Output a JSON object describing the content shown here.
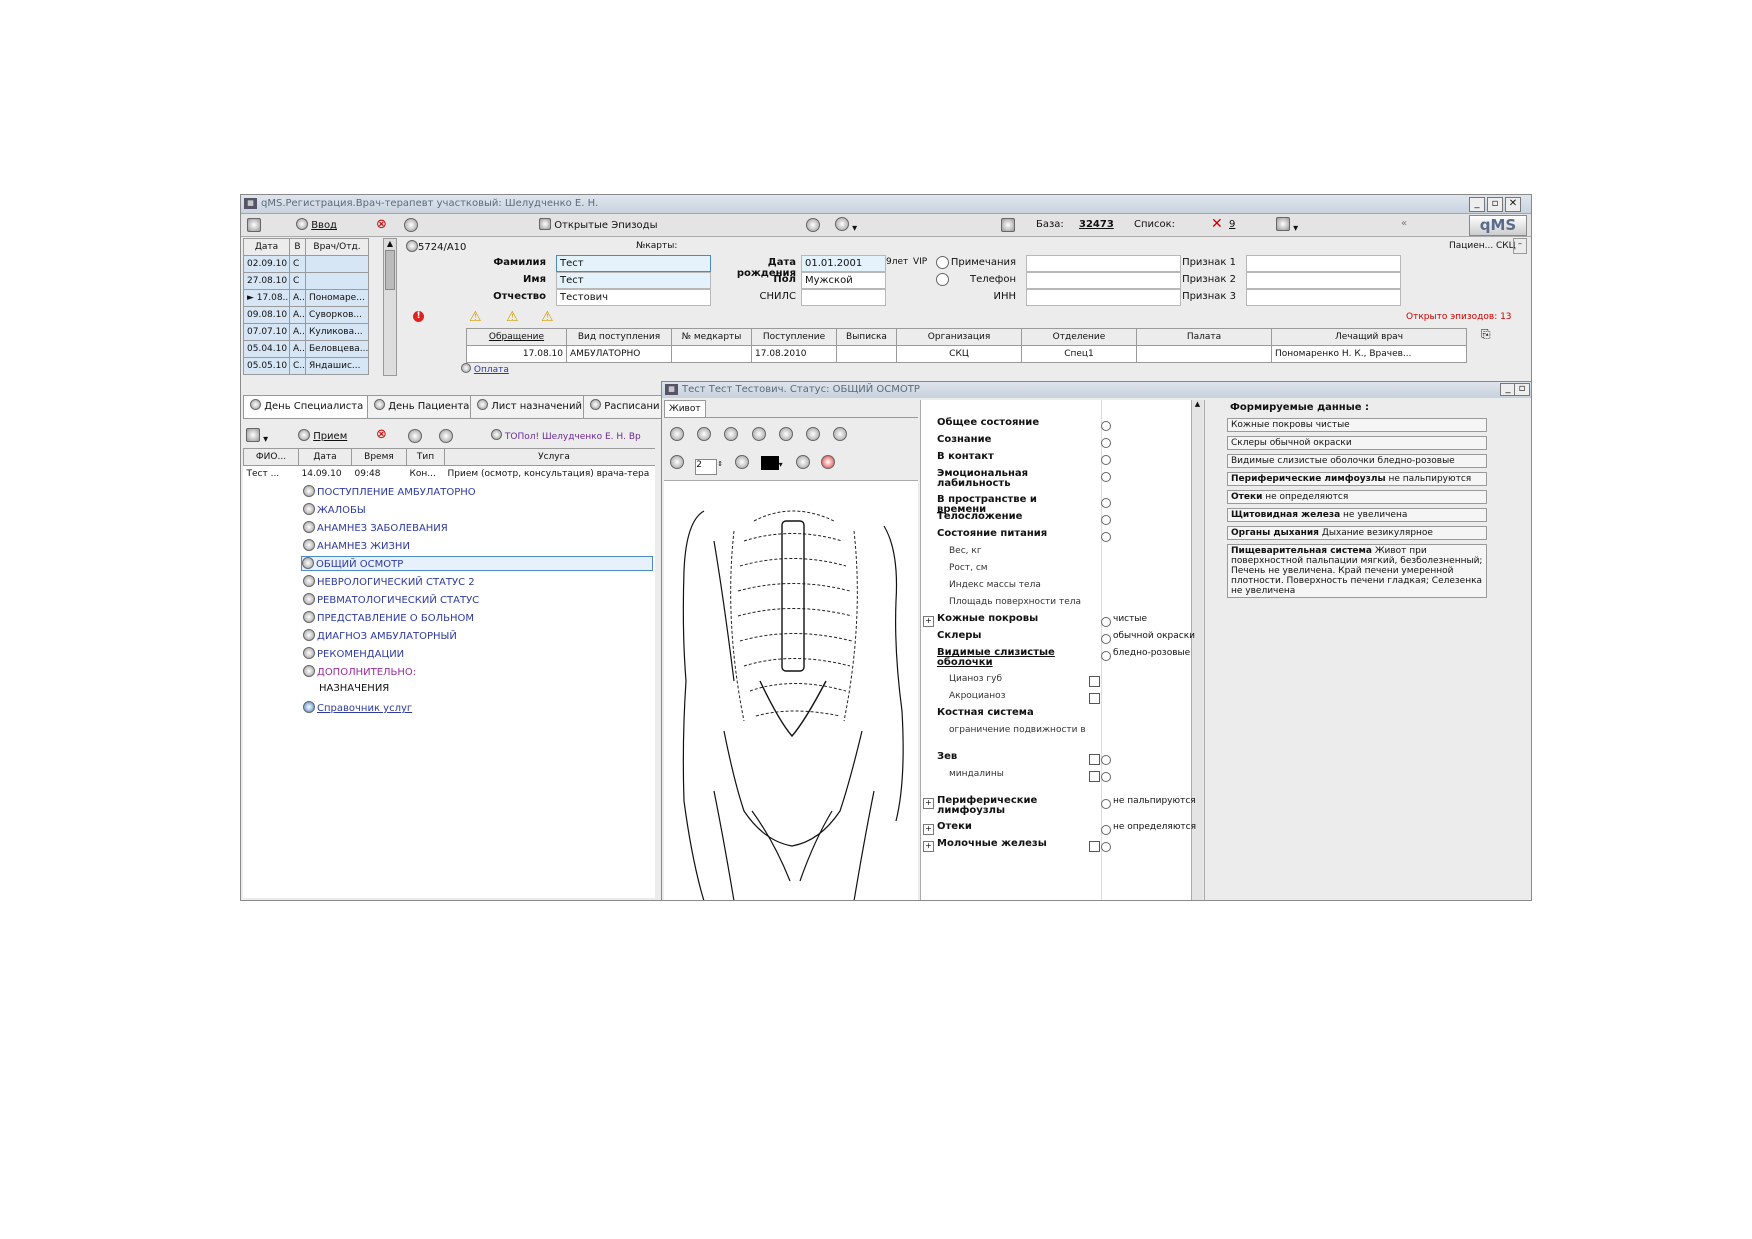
{
  "window": {
    "title": "qMS.Регистрация.Врач-терапевт участковый: Шелудченко Е. Н.",
    "min": "_",
    "max": "▫",
    "close": "✕"
  },
  "toolbar": {
    "vvod": "Ввод",
    "open_episodes": "Открытые Эпизоды",
    "baza_label": "База:",
    "baza_value": "32473",
    "spisok_label": "Список:",
    "spisok_value": "9",
    "logo": "qMS"
  },
  "visits_table": {
    "headers": [
      "Дата",
      "В",
      "Врач/Отд."
    ],
    "rows": [
      [
        "02.09.10",
        "С",
        ""
      ],
      [
        "27.08.10",
        "С",
        ""
      ],
      [
        "► 17.08...",
        "А...",
        "Пономаре..."
      ],
      [
        "09.08.10",
        "А...",
        "Суворков..."
      ],
      [
        "07.07.10",
        "А...",
        "Куликова..."
      ],
      [
        "05.04.10",
        "А...",
        "Беловцева..."
      ],
      [
        "05.05.10",
        "С...",
        "Яндашис..."
      ]
    ]
  },
  "patient": {
    "id": "5724/А10",
    "nkarty": "№карты:",
    "patient_label": "Пациен...",
    "patient_value": "СКЦ",
    "familia_label": "Фамилия",
    "familia": "Тест",
    "imya_label": "Имя",
    "imya": "Тест",
    "otchestvo_label": "Отчество",
    "otchestvo": "Тестович",
    "dob_label": "Дата рождения",
    "dob": "01.01.2001",
    "age": "9лет",
    "vip": "VIP",
    "pol_label": "Пол",
    "pol": "Мужской",
    "snils_label": "СНИЛС",
    "prim_label": "Примечания",
    "tel_label": "Телефон",
    "inn_label": "ИНН",
    "p1": "Признак 1",
    "p2": "Признак 2",
    "p3": "Признак 3",
    "open_episodes": "Открыто эпизодов: 13",
    "oplata": "Оплата"
  },
  "episodes_table": {
    "headers": [
      "Обращение",
      "Вид поступления",
      "№ медкарты",
      "Поступление",
      "Выписка",
      "Организация",
      "Отделение",
      "Палата",
      "Лечащий врач"
    ],
    "row": [
      "17.08.10",
      "АМБУЛАТОРНО",
      "",
      "17.08.2010",
      "",
      "СКЦ",
      "Спец1",
      "",
      "Пономаренко Н. К., Врачев..."
    ]
  },
  "tabs": [
    "День Специалиста",
    "День Пациента",
    "Лист назначений",
    "Расписани"
  ],
  "appointments": {
    "toolbar_priem": "Прием",
    "doctor": "ТОПол! Шелудченко Е. Н. Вр",
    "headers": [
      "ФИО...",
      "Дата",
      "Время",
      "Тип",
      "Услуга"
    ],
    "row": [
      "Тест ...",
      "14.09.10",
      "09:48",
      "Кон...",
      "Прием (осмотр, консультация) врача-тера"
    ],
    "tree": [
      "ПОСТУПЛЕНИЕ АМБУЛАТОРНО",
      "ЖАЛОБЫ",
      "АНАМНЕЗ ЗАБОЛЕВАНИЯ",
      "АНАМНЕЗ ЖИЗНИ",
      "ОБЩИЙ ОСМОТР",
      "НЕВРОЛОГИЧЕСКИЙ СТАТУС 2",
      "РЕВМАТОЛОГИЧЕСКИЙ СТАТУС",
      "ПРЕДСТАВЛЕНИЕ О БОЛЬНОМ",
      "ДИАГНОЗ АМБУЛАТОРНЫЙ",
      "РЕКОМЕНДАЦИИ",
      "ДОПОЛНИТЕЛЬНО:",
      "НАЗНАЧЕНИЯ",
      "Справочник услуг"
    ]
  },
  "exam_window": {
    "title": "Тест Тест Тестович. Статус: ОБЩИЙ ОСМОТР",
    "image_tab": "Живот",
    "pen_size": "2",
    "rows": [
      {
        "label": "Общее состояние",
        "kind": "radio",
        "value": ""
      },
      {
        "label": "Сознание",
        "kind": "radio",
        "value": ""
      },
      {
        "label": "В контакт",
        "kind": "radio",
        "value": ""
      },
      {
        "label": "Эмоциональная лабильность",
        "kind": "radio",
        "value": ""
      },
      {
        "label": "В пространстве и времени",
        "kind": "radio",
        "value": ""
      },
      {
        "label": "Телосложение",
        "kind": "radio",
        "value": ""
      },
      {
        "label": "Состояние питания",
        "kind": "radio",
        "value": ""
      },
      {
        "label": "Вес, кг",
        "kind": "sub",
        "value": ""
      },
      {
        "label": "Рост, см",
        "kind": "sub",
        "value": ""
      },
      {
        "label": "Индекс массы тела",
        "kind": "sub",
        "value": ""
      },
      {
        "label": "Площадь поверхности тела",
        "kind": "sub",
        "value": ""
      },
      {
        "label": "Кожные покровы",
        "kind": "plusradio",
        "value": "чистые"
      },
      {
        "label": "Склеры",
        "kind": "radio",
        "value": "обычной окраски"
      },
      {
        "label": "Видимые слизистые оболочки",
        "kind": "radio",
        "value": "бледно-розовые"
      },
      {
        "label": "Цианоз губ",
        "kind": "subcb",
        "value": ""
      },
      {
        "label": "Акроцианоз",
        "kind": "subcb",
        "value": ""
      },
      {
        "label": "Костная система",
        "kind": "head",
        "value": ""
      },
      {
        "label": "ограничение подвижности в",
        "kind": "sub",
        "value": ""
      },
      {
        "label": "Зев",
        "kind": "cbradio",
        "value": ""
      },
      {
        "label": "миндалины",
        "kind": "subcbradio",
        "value": ""
      },
      {
        "label": "Периферические лимфоузлы",
        "kind": "plusradio",
        "value": "не пальпируются"
      },
      {
        "label": "Отеки",
        "kind": "plusradio",
        "value": "не определяются"
      },
      {
        "label": "Молочные железы",
        "kind": "pluscbradio",
        "value": ""
      }
    ]
  },
  "formed_data": {
    "title": "Формируемые данные :",
    "items": [
      {
        "bold": "",
        "text": "Кожные покровы чистые"
      },
      {
        "bold": "",
        "text": "Склеры обычной окраски"
      },
      {
        "bold": "",
        "text": "Видимые слизистые оболочки бледно-розовые"
      },
      {
        "bold": "Периферические лимфоузлы",
        "text": " не пальпируются"
      },
      {
        "bold": "Отеки",
        "text": " не определяются"
      },
      {
        "bold": "Щитовидная железа",
        "text": " не увеличена"
      },
      {
        "bold": "Органы дыхания",
        "text": " Дыхание везикулярное"
      },
      {
        "bold": "Пищеварительная система",
        "text": " Живот при поверхностной пальпации мягкий, безболезненный; Печень не увеличена. Край печени умеренной плотности. Поверхность печени гладкая; Селезенка не увеличена"
      }
    ]
  }
}
